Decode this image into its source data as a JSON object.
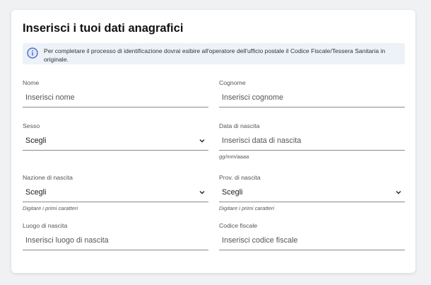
{
  "form": {
    "title": "Inserisci i tuoi dati anagrafici",
    "info_text": "Per completare il processo di identificazione dovrai esibire all'operatore dell'ufficio postale il Codice Fiscale/Tessera Sanitaria in originale.",
    "fields": {
      "nome": {
        "label": "Nome",
        "placeholder": "Inserisci nome"
      },
      "cognome": {
        "label": "Cognome",
        "placeholder": "Inserisci cognome"
      },
      "sesso": {
        "label": "Sesso",
        "value": "Scegli"
      },
      "data_nascita": {
        "label": "Data di nascita",
        "placeholder": "Inserisci data di nascita",
        "hint": "gg/mm/aaaa"
      },
      "nazione_nascita": {
        "label": "Nazione di nascita",
        "value": "Scegli",
        "hint": "Digitare i primi caratteri"
      },
      "prov_nascita": {
        "label": "Prov. di nascita",
        "value": "Scegli",
        "hint": "Digitare i primi caratteri"
      },
      "luogo_nascita": {
        "label": "Luogo di nascita",
        "placeholder": "Inserisci luogo di nascita"
      },
      "codice_fiscale": {
        "label": "Codice fiscale",
        "placeholder": "Inserisci codice fiscale"
      }
    }
  },
  "icons": {
    "info": "info-circle-icon",
    "dropdown": "chevron-down-icon"
  },
  "colors": {
    "info_bg": "#edf1f8",
    "info_icon": "#3b63c4"
  }
}
